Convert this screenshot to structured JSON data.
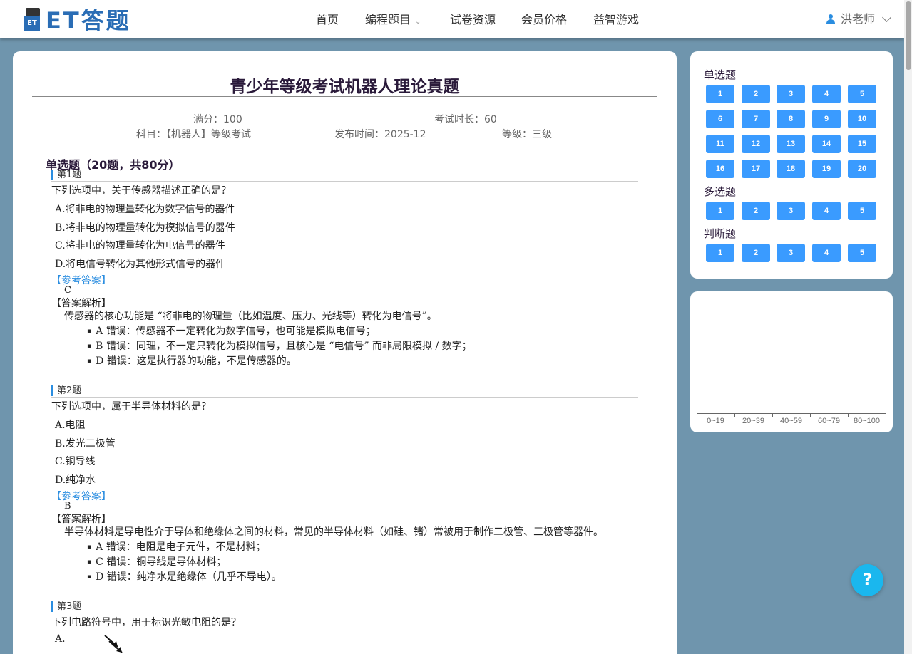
{
  "header": {
    "logo_badge": "ET",
    "logo_text": "ET答题",
    "nav": [
      "首页",
      "编程题目",
      "试卷资源",
      "会员价格",
      "益智游戏"
    ],
    "user_name": "洪老师"
  },
  "paper": {
    "title": "青少年等级考试机器人理论真题",
    "full_score": "满分：100",
    "duration": "考试时长：60",
    "subject": "科目：【机器人】等级考试",
    "publish_time": "发布时间：2025-12",
    "level": "等级：三级",
    "section_title": "单选题（20题，共80分）",
    "answer_label": "【参考答案】",
    "analysis_label": "【答案解析】",
    "questions": [
      {
        "label": "第1题",
        "stem": "下列选项中，关于传感器描述正确的是？",
        "options": [
          "A.将非电的物理量转化为数字信号的器件",
          "B.将非电的物理量转化为模拟信号的器件",
          "C.将非电的物理量转化为电信号的器件",
          "D.将电信号转化为其他形式信号的器件"
        ],
        "answer": "C",
        "analysis": "传感器的核心功能是 “将非电的物理量（比如温度、压力、光线等）转化为电信号”。",
        "points": [
          "A 错误：传感器不一定转化为数字信号，也可能是模拟电信号；",
          "B 错误：同理，不一定只转化为模拟信号，且核心是 “电信号” 而非局限模拟 / 数字；",
          "D 错误：这是执行器的功能，不是传感器的。"
        ]
      },
      {
        "label": "第2题",
        "stem": "下列选项中，属于半导体材料的是？",
        "options": [
          "A.电阻",
          "B.发光二极管",
          "C.铜导线",
          "D.纯净水"
        ],
        "answer": "B",
        "analysis": "半导体材料是导电性介于导体和绝缘体之间的材料，常见的半导体材料（如硅、锗）常被用于制作二极管、三极管等器件。",
        "points": [
          "A 错误：电阻是电子元件，不是材料；",
          "C 错误：铜导线是导体材料；",
          "D 错误：纯净水是绝缘体（几乎不导电）。"
        ]
      },
      {
        "label": "第3题",
        "stem": "下列电路符号中，用于标识光敏电阻的是？",
        "options": [
          "A."
        ]
      }
    ]
  },
  "sidebar": {
    "groups": [
      {
        "label": "单选题",
        "items": [
          "1",
          "2",
          "3",
          "4",
          "5",
          "6",
          "7",
          "8",
          "9",
          "10",
          "11",
          "12",
          "13",
          "14",
          "15",
          "16",
          "17",
          "18",
          "19",
          "20"
        ]
      },
      {
        "label": "多选题",
        "items": [
          "1",
          "2",
          "3",
          "4",
          "5"
        ]
      },
      {
        "label": "判断题",
        "items": [
          "1",
          "2",
          "3",
          "4",
          "5"
        ]
      }
    ]
  },
  "chart_data": {
    "type": "bar",
    "categories": [
      "0~19",
      "20~39",
      "40~59",
      "60~79",
      "80~100"
    ],
    "values": [
      0,
      0,
      0,
      0,
      0
    ],
    "title": "",
    "xlabel": "",
    "ylabel": ""
  },
  "help_button": "?",
  "colors": {
    "accent": "#3a9bff",
    "background": "#6f95ad",
    "title": "#2a1a3a",
    "help": "#1ab7ee"
  }
}
